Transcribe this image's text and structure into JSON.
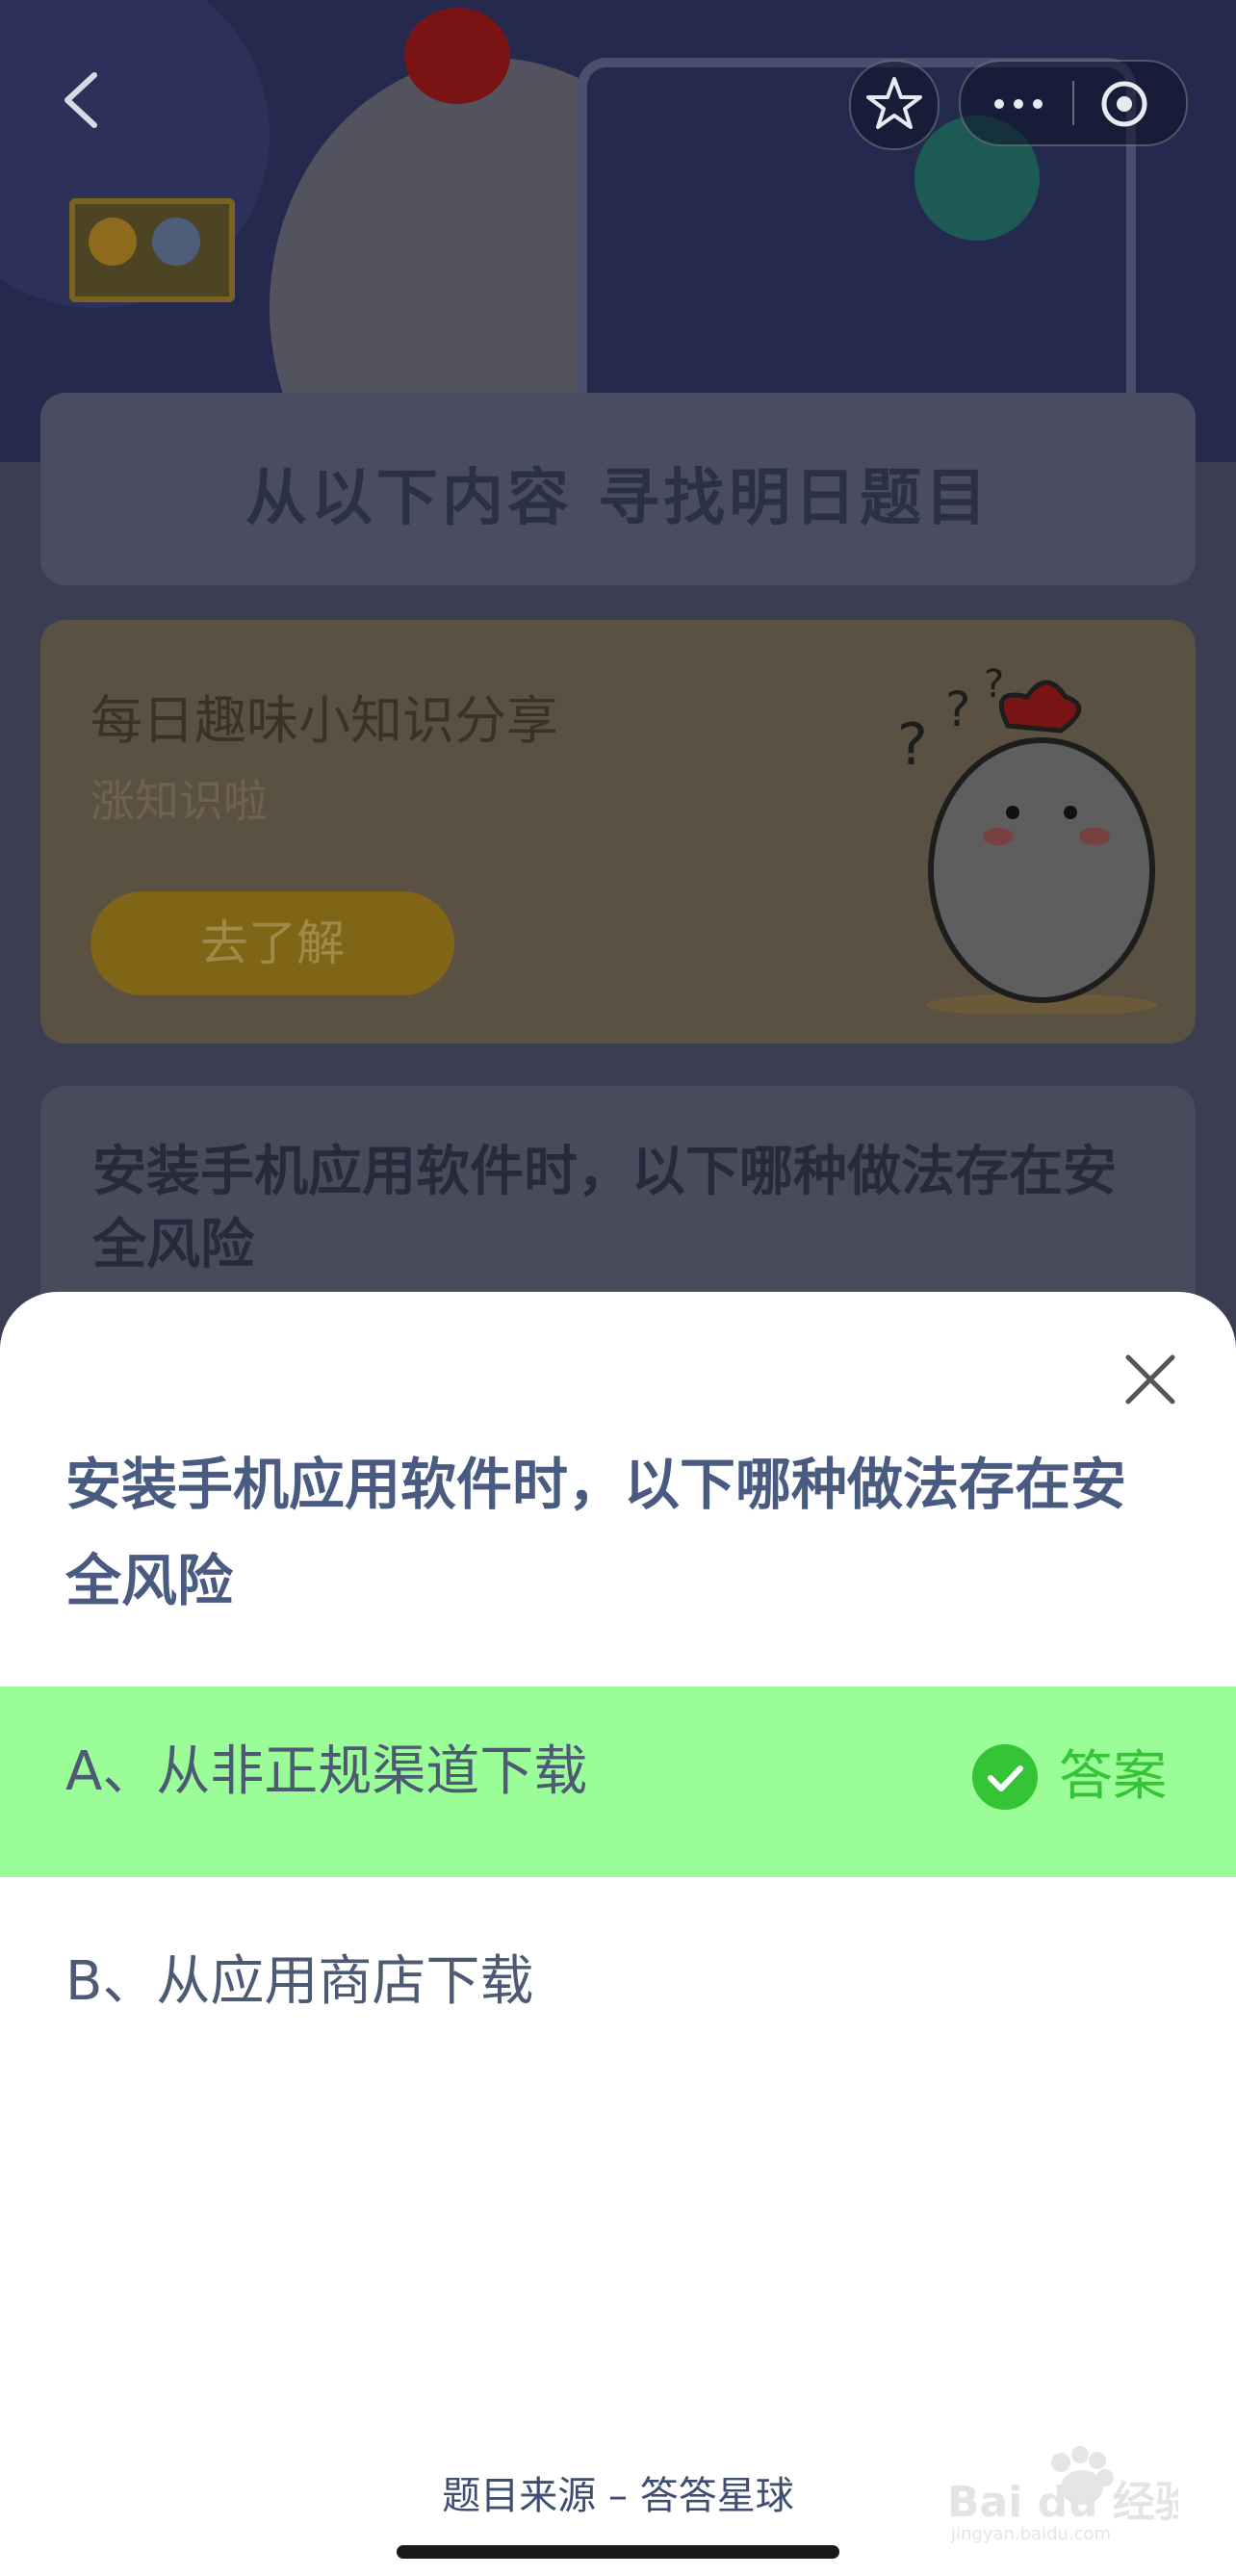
{
  "background": {
    "banner_title": "从以下内容  寻找明日题目",
    "fact_card": {
      "title": "每日趣味小知识分享",
      "subtitle": "涨知识啦",
      "button_label": "去了解"
    },
    "question_card_text": "安装手机应用软件时，以下哪种做法存在安全风险"
  },
  "nav": {
    "back_icon": "chevron-left-icon",
    "favorite_icon": "star-icon",
    "more_icon": "more-dots-icon",
    "close_app_icon": "target-circle-icon"
  },
  "sheet": {
    "question": "安装手机应用软件时，以下哪种做法存在安全风险",
    "options": [
      {
        "label": "A、从非正规渠道下载",
        "correct": true
      },
      {
        "label": "B、从应用商店下载",
        "correct": false
      }
    ],
    "answer_label": "答案",
    "source": "题目来源 – 答答星球"
  },
  "watermark": {
    "brand": "Bai du 经验",
    "url": "jingyan.baidu.com"
  },
  "colors": {
    "correct_bg": "#9bfd98",
    "answer_green": "#35c436",
    "question_blue": "#4a5b82"
  }
}
